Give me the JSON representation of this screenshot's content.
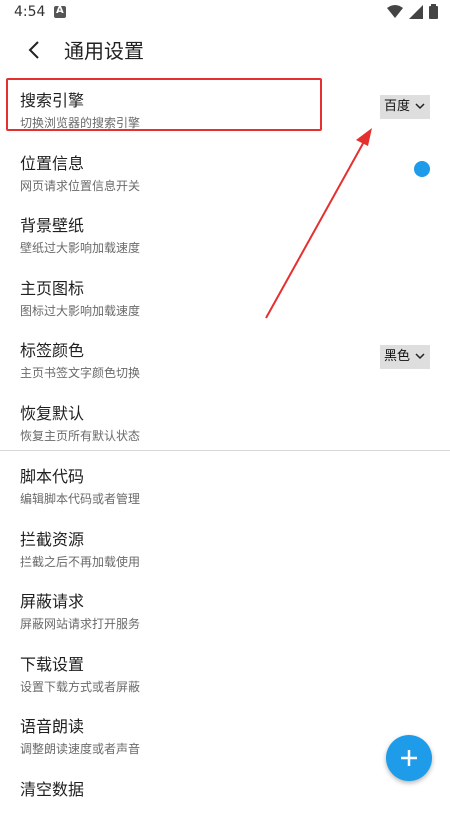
{
  "status_bar": {
    "time": "4:54"
  },
  "header": {
    "title": "通用设置"
  },
  "settings": [
    {
      "title": "搜索引擎",
      "subtitle": "切换浏览器的搜索引擎",
      "control": "select",
      "value": "百度"
    },
    {
      "title": "位置信息",
      "subtitle": "网页请求位置信息开关",
      "control": "toggle-dot"
    },
    {
      "title": "背景壁纸",
      "subtitle": "壁纸过大影响加载速度"
    },
    {
      "title": "主页图标",
      "subtitle": "图标过大影响加载速度"
    },
    {
      "title": "标签颜色",
      "subtitle": "主页书签文字颜色切换",
      "control": "select",
      "value": "黑色"
    },
    {
      "title": "恢复默认",
      "subtitle": "恢复主页所有默认状态"
    }
  ],
  "settings2": [
    {
      "title": "脚本代码",
      "subtitle": "编辑脚本代码或者管理"
    },
    {
      "title": "拦截资源",
      "subtitle": "拦截之后不再加载使用"
    },
    {
      "title": "屏蔽请求",
      "subtitle": "屏蔽网站请求打开服务"
    },
    {
      "title": "下载设置",
      "subtitle": "设置下载方式或者屏蔽"
    },
    {
      "title": "语音朗读",
      "subtitle": "调整朗读速度或者声音"
    },
    {
      "title": "清空数据",
      "subtitle": ""
    }
  ],
  "colors": {
    "accent": "#1e9be9",
    "annotation": "#e53030"
  }
}
